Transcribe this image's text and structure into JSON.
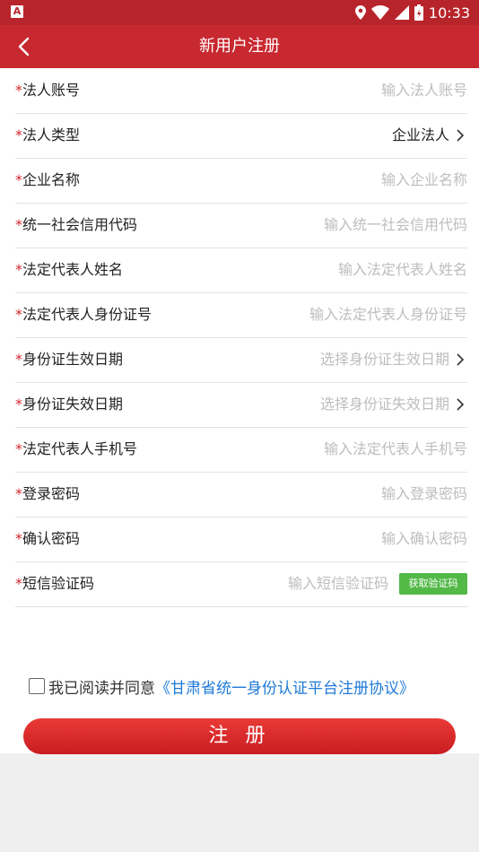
{
  "statusbar": {
    "left_icon": "A",
    "time": "10:33",
    "icons": [
      "location-icon",
      "wifi-icon",
      "signal-icon",
      "battery-icon"
    ]
  },
  "header": {
    "title": "新用户注册",
    "back_icon": "chevron-left-icon"
  },
  "form": {
    "required_mark": "*",
    "rows": [
      {
        "label": "法人账号",
        "placeholder": "输入法人账号"
      },
      {
        "label": "法人类型",
        "value": "企业法人"
      },
      {
        "label": "企业名称",
        "placeholder": "输入企业名称"
      },
      {
        "label": "统一社会信用代码",
        "placeholder": "输入统一社会信用代码"
      },
      {
        "label": "法定代表人姓名",
        "placeholder": "输入法定代表人姓名"
      },
      {
        "label": "法定代表人身份证号",
        "placeholder": "输入法定代表人身份证号"
      },
      {
        "label": "身份证生效日期",
        "placeholder": "选择身份证生效日期"
      },
      {
        "label": "身份证失效日期",
        "placeholder": "选择身份证失效日期"
      },
      {
        "label": "法定代表人手机号",
        "placeholder": "输入法定代表人手机号"
      },
      {
        "label": "登录密码",
        "placeholder": "输入登录密码"
      },
      {
        "label": "确认密码",
        "placeholder": "输入确认密码"
      },
      {
        "label": "短信验证码",
        "placeholder": "输入短信验证码",
        "button": "获取验证码"
      }
    ]
  },
  "agreement": {
    "text": "我已阅读并同意",
    "link": "《甘肃省统一身份认证平台注册协议》",
    "checked": false
  },
  "submit": {
    "label": "注 册"
  },
  "colors": {
    "header": "#c8282f",
    "required": "#d0262d",
    "link": "#1f7ad6",
    "sms_button": "#52b947",
    "submit": "#d8262b"
  }
}
